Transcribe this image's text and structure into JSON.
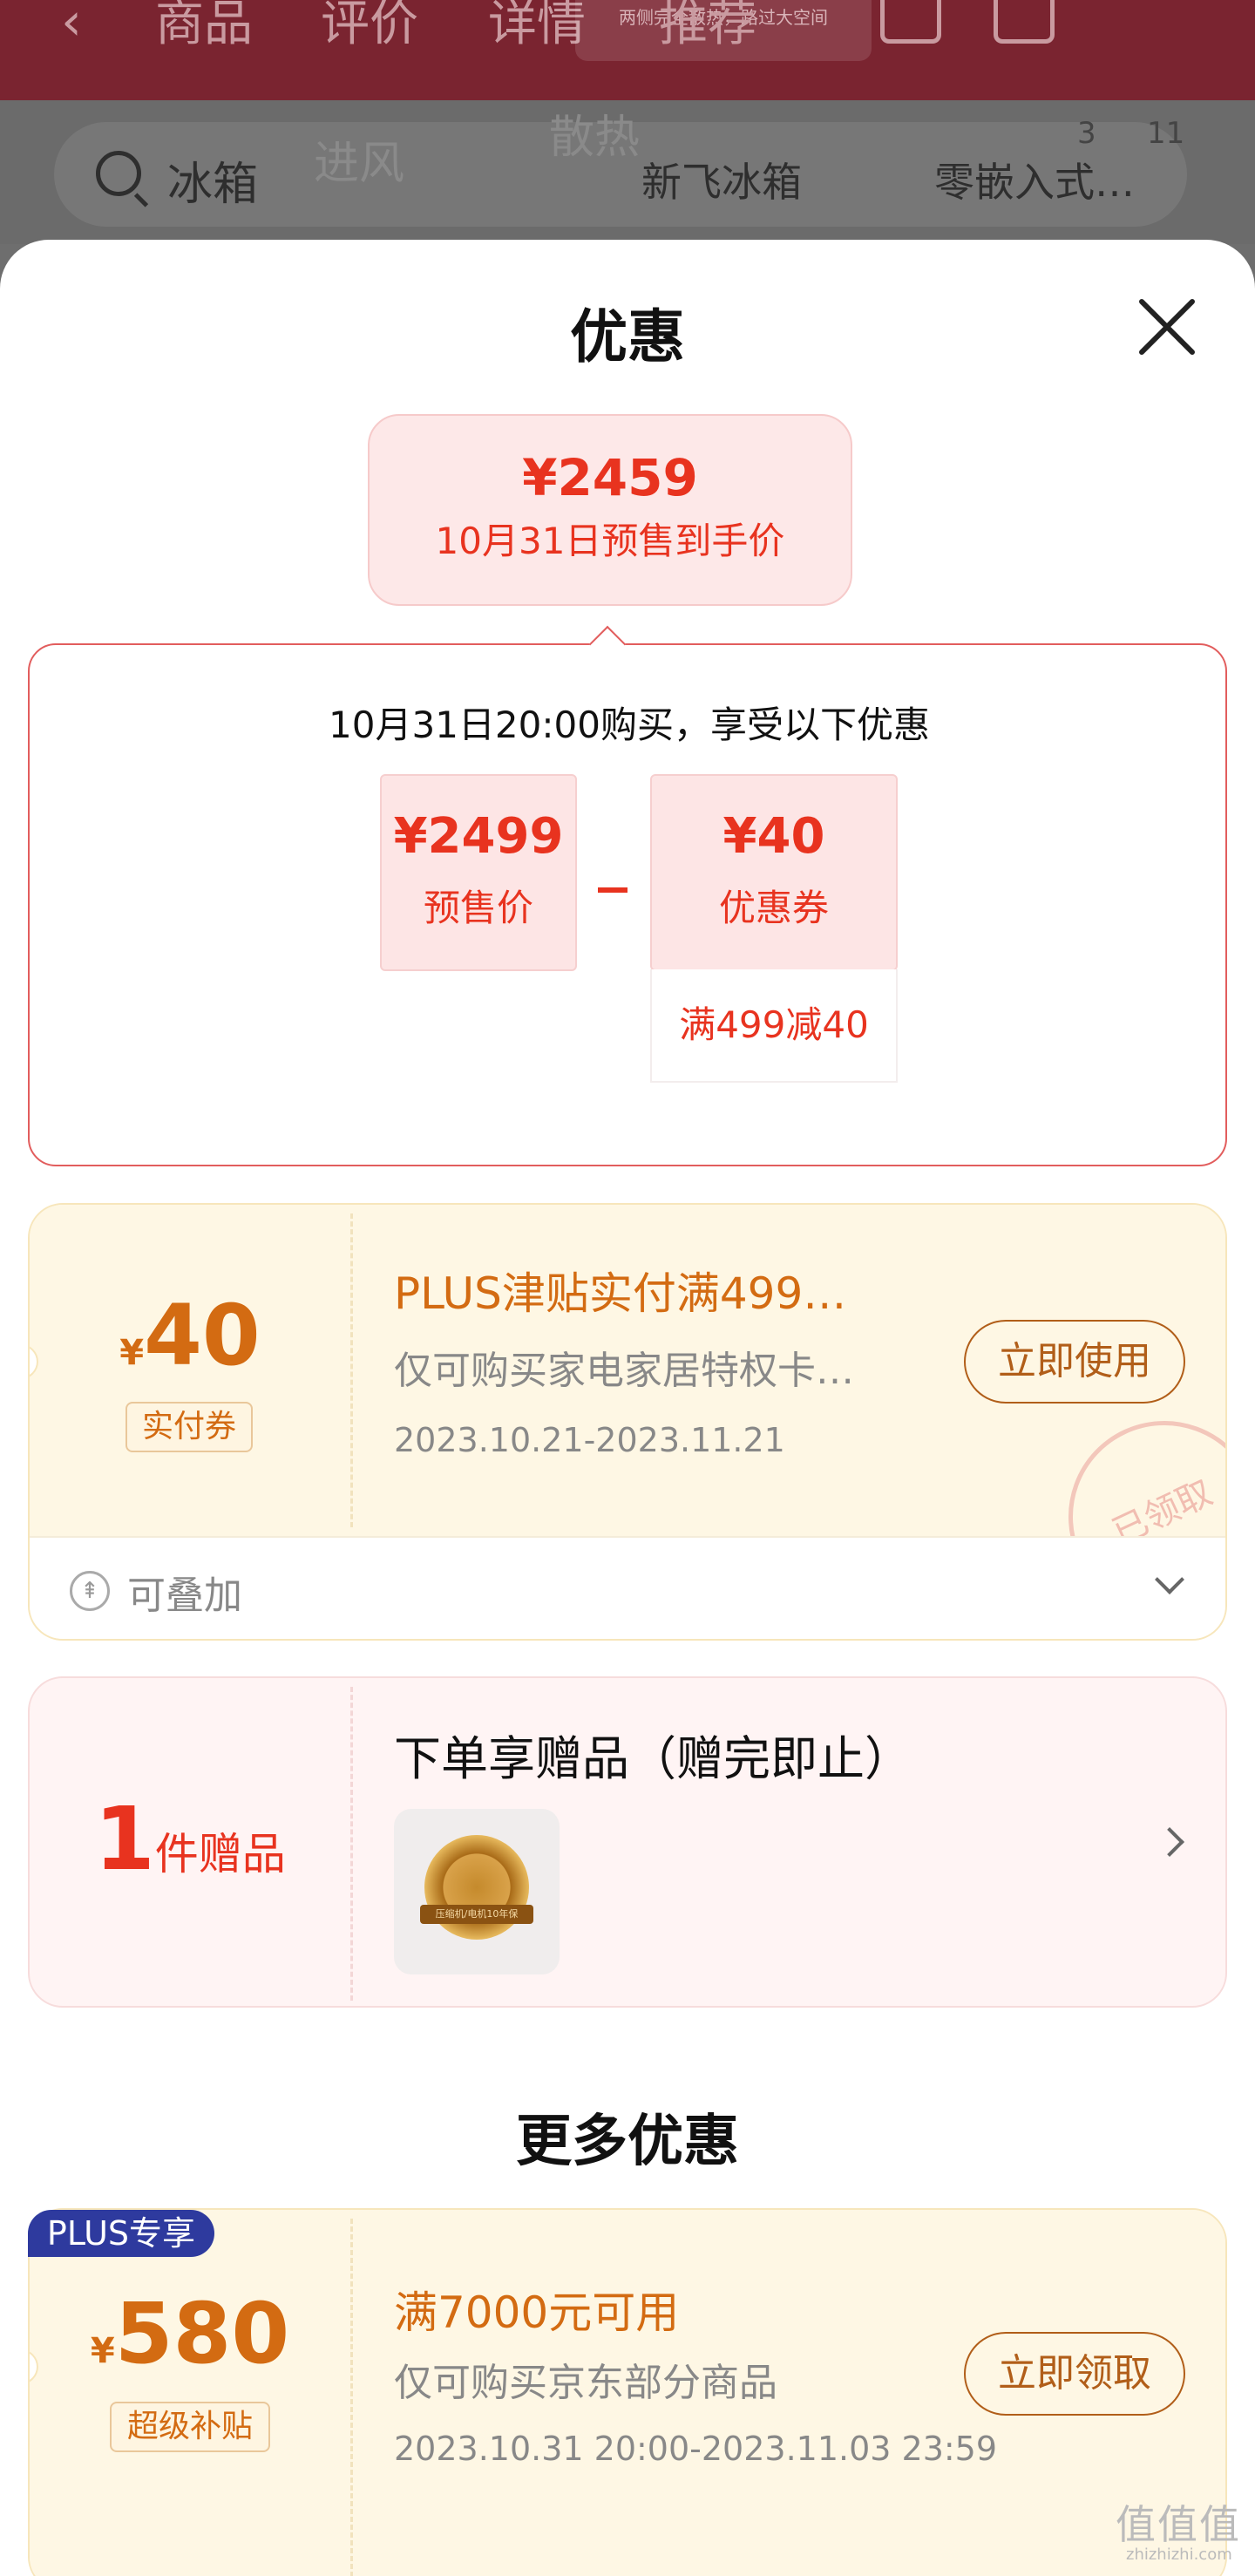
{
  "background": {
    "nav_tabs": [
      "商品",
      "评价",
      "详情",
      "推荐"
    ],
    "tag_text": "两侧完全散热，路过大空间",
    "search_text": "冰箱",
    "chips": [
      "新飞冰箱",
      "零嵌入式…"
    ],
    "counts": [
      "3",
      "11"
    ],
    "overlay_words": [
      "进风",
      "散热"
    ]
  },
  "sheet": {
    "title": "优惠",
    "close_icon": "close-icon"
  },
  "final_price": {
    "amount": "¥2459",
    "label": "10月31日预售到手价"
  },
  "breakdown": {
    "description": "10月31日20:00购买，享受以下优惠",
    "presale": {
      "value": "¥2499",
      "label": "预售价"
    },
    "coupon": {
      "value": "¥40",
      "label": "优惠券",
      "condition": "满499减40"
    }
  },
  "coupon1": {
    "currency": "¥",
    "amount": "40",
    "badge": "实付券",
    "title": "PLUS津贴实付满499…",
    "note": "仅可购买家电家居特权卡…",
    "date": "2023.10.21-2023.11.21",
    "action": "立即使用",
    "stamp": "已领取",
    "footer": "可叠加",
    "stack_icon": "stack-icon"
  },
  "gift": {
    "count": "1",
    "unit": "件赠品",
    "title": "下单享赠品（赠完即止）",
    "item_label": "压缩机/电机10年保"
  },
  "more_title": "更多优惠",
  "coupon2": {
    "tag": "PLUS专享",
    "currency": "¥",
    "amount": "580",
    "badge": "超级补贴",
    "title": "满7000元可用",
    "note": "仅可购买京东部分商品",
    "date": "2023.10.31 20:00-2023.11.03 23:59",
    "action": "立即领取"
  },
  "watermark": {
    "main": "值值值",
    "sub": "zhizhizhi.com"
  },
  "colors": {
    "accent_red": "#e8331f",
    "coupon_orange": "#d36b12",
    "plus_blue": "#2e3a9e"
  }
}
